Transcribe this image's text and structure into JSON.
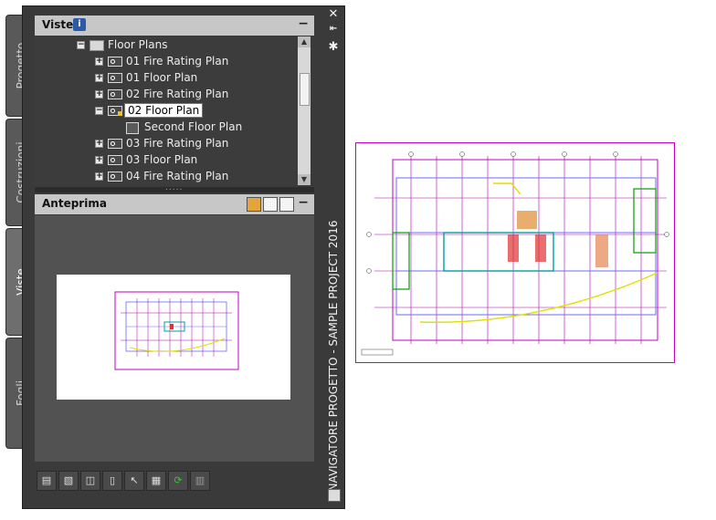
{
  "tabs": [
    {
      "label": "Progetto"
    },
    {
      "label": "Costruzioni"
    },
    {
      "label": "Viste"
    },
    {
      "label": "Fogli"
    }
  ],
  "palette": {
    "title": "NAVIGATORE PROGETTO - SAMPLE PROJECT 2016",
    "views_header": "Viste",
    "preview_header": "Anteprima"
  },
  "tree": {
    "items": [
      {
        "label": "Floor Plans"
      },
      {
        "label": "01 Fire Rating Plan"
      },
      {
        "label": "01 Floor Plan"
      },
      {
        "label": "02 Fire Rating Plan"
      },
      {
        "label": "02 Floor Plan"
      },
      {
        "label": "Second Floor Plan"
      },
      {
        "label": "03 Fire Rating Plan"
      },
      {
        "label": "03 Floor Plan"
      },
      {
        "label": "04 Fire Rating Plan"
      }
    ]
  },
  "colors": {
    "panel_bg": "#3a3a3a",
    "header_bg": "#c7c7c7",
    "drawing_magenta": "#c400c4",
    "drawing_blue": "#6a6aff"
  }
}
